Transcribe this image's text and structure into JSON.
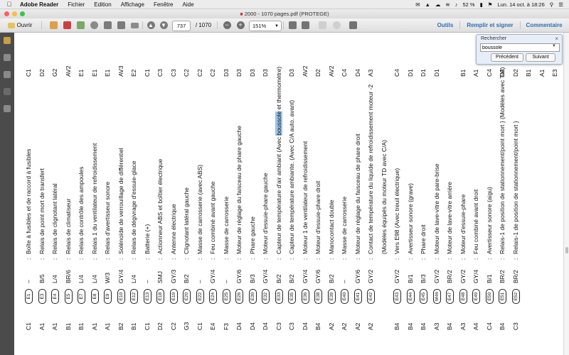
{
  "menubar": {
    "app_name": "Adobe Reader",
    "menus": [
      "Fichier",
      "Edition",
      "Affichage",
      "Fenêtre",
      "Aide"
    ],
    "battery": "52 %",
    "datetime": "Lun. 14 oct. à 18:26"
  },
  "window": {
    "title": "2000 - 1070 pages.pdf (PROTEGE)"
  },
  "toolbar": {
    "open_label": "Ouvrir",
    "page_current": "737",
    "page_total": "/ 1070",
    "zoom": "151%",
    "tools_label": "Outils",
    "fill_sign_label": "Remplir et signer",
    "comment_label": "Commentaire"
  },
  "search": {
    "title": "Rechercher",
    "query": "boussole",
    "prev_label": "Précédent",
    "next_label": "Suivant"
  },
  "document": {
    "rows": [
      {
        "ref": "C1",
        "code": "E1",
        "wire": "–",
        "desc": "Boîte à fusibles et de raccord à fusibles",
        "grid": "C1"
      },
      {
        "ref": "A1",
        "code": "E3",
        "wire": "B/5",
        "desc": "Relais de point mort de transfert",
        "grid": "D2"
      },
      {
        "ref": "A1",
        "code": "E4",
        "wire": "L/4",
        "desc": "Relais de clignotant latéral",
        "grid": "G2"
      },
      {
        "ref": "B1",
        "code": "E5",
        "wire": "BR/6",
        "desc": "Relais de climatiseur",
        "grid": "AV2"
      },
      {
        "ref": "B1",
        "code": "E7",
        "wire": "L/4",
        "desc": "Relais de contrôle des ampoules",
        "grid": "E1"
      },
      {
        "ref": "A1",
        "code": "E8",
        "wire": "L/4",
        "desc": "Relais 1 du ventilateur de refroidissement",
        "grid": "E1"
      },
      {
        "ref": "A1",
        "code": "E9",
        "wire": "W/3",
        "desc": "Relais d'avertisseur sonore",
        "grid": "E1"
      },
      {
        "ref": "B2",
        "code": "E10",
        "wire": "GY/4",
        "desc": "Solénoïde de verrouillage de différentiel",
        "grid": "AV3"
      },
      {
        "ref": "B1",
        "code": "E12",
        "wire": "L/4",
        "desc": "Relais de dégivrage d'essuie-glace",
        "grid": "E2"
      },
      {
        "ref": "C1",
        "code": "E13",
        "wire": "–",
        "desc": "Batterie (+)",
        "grid": "C1"
      },
      {
        "ref": "D2",
        "code": "E18",
        "wire": "SMJ",
        "desc": "Actionneur ABS et boîtier électrique",
        "grid": "C3"
      },
      {
        "ref": "C2",
        "code": "E19",
        "wire": "GY/3",
        "desc": "Antenne électrique",
        "grid": "C3"
      },
      {
        "ref": "G3",
        "code": "E20",
        "wire": "B/2",
        "desc": "Clignotant latéral gauche",
        "grid": "C2"
      },
      {
        "ref": "C1",
        "code": "E22",
        "wire": "–",
        "desc": "Masse de carrosserie (avec ABS)",
        "grid": "C2"
      },
      {
        "ref": "E4",
        "code": "E24",
        "wire": "GY/4",
        "desc": "Feu combiné avant gauche",
        "grid": "C2"
      },
      {
        "ref": "F3",
        "code": "E25",
        "wire": "–",
        "desc": "Masse de carrosserie",
        "grid": "D3"
      },
      {
        "ref": "D4",
        "code": "E26",
        "wire": "GY/6",
        "desc": "Moteur de réglage du faisceau de phare gauche",
        "grid": "D3"
      },
      {
        "ref": "D4",
        "code": "E30",
        "wire": "B/3",
        "desc": "Phare gauche",
        "grid": "D3"
      },
      {
        "ref": "D4",
        "code": "E32",
        "wire": "GY/4",
        "desc": "Moteur d'essuie-phare gauche",
        "grid": "D3"
      },
      {
        "ref": "C3",
        "code": "E33",
        "wire": "B/2",
        "desc": "Capteur de température d'air ambiant (Avec boussole et thermomètre)",
        "hl": "boussole",
        "grid": ""
      },
      {
        "ref": "C3",
        "code": "E35",
        "wire": "B/2",
        "desc": "Capteur de température ambiante. (Avec C/A auto. avant)",
        "grid": "D3"
      },
      {
        "ref": "D4",
        "code": "E36",
        "wire": "GY/4",
        "desc": "Moteur 1 de ventilateur de refroidissement",
        "grid": "AV2"
      },
      {
        "ref": "B4",
        "code": "E38",
        "wire": "GY/6",
        "desc": "Moteur d'essuie-phare droit",
        "grid": "D2"
      },
      {
        "ref": "A2",
        "code": "E39",
        "wire": "B/2",
        "desc": "Manocontact double",
        "grid": "AV2"
      },
      {
        "ref": "A2",
        "code": "E40",
        "wire": "–",
        "desc": "Masse de carrosserie",
        "grid": "C4"
      },
      {
        "ref": "A2",
        "code": "E41",
        "wire": "GY/6",
        "desc": "Moteur de réglage du faisceau de phare droit",
        "grid": "D4"
      },
      {
        "ref": "A2",
        "code": "E42",
        "wire": "GY/2",
        "desc": "Contact de température du liquide de refroidissement moteur -2",
        "grid": "A3"
      },
      {
        "ref": "",
        "code": "",
        "wire": "",
        "desc": "(Modèles équipés du moteur TD avec C/A)",
        "grid": ""
      },
      {
        "ref": "B4",
        "code": "E43",
        "wire": "GY/2",
        "desc": "Vers E98 (Avec treuil électrique)",
        "grid": "C4"
      },
      {
        "ref": "B4",
        "code": "E44",
        "wire": "B/1",
        "desc": "Avertisseur sonore (grave)",
        "grid": "D1"
      },
      {
        "ref": "B4",
        "code": "E45",
        "wire": "B/3",
        "desc": "Phare droit",
        "grid": "D1"
      },
      {
        "ref": "A3",
        "code": "M46",
        "wire": "GY/2",
        "desc": "Moteur de lave-vitre de pare-brise",
        "grid": "D1"
      },
      {
        "ref": "B4",
        "code": "E47",
        "wire": "BR/2",
        "desc": "Moteur de lave-vitre arrière",
        "grid": ""
      },
      {
        "ref": "A3",
        "code": "E48",
        "wire": "GY/2",
        "desc": "Moteur d'essuie-phare",
        "grid": "B1"
      },
      {
        "ref": "A4",
        "code": "E49",
        "wire": "GY/4",
        "desc": "Feu combiné avant droit",
        "grid": "A1"
      },
      {
        "ref": "C4",
        "code": "E50",
        "wire": "B/1",
        "desc": "Avertisseur sonore (aigu)",
        "grid": "C4"
      },
      {
        "ref": "B4",
        "code": "E51",
        "wire": "BR/2",
        "desc": "Relais-1 de position de stationnement/point mort  } (Modèles avec T/A)",
        "grid": "D2"
      },
      {
        "ref": "C3",
        "code": "E52",
        "wire": "BR/2",
        "desc": "Relais-1 de position de stationnement/point mort  }",
        "grid": "D2"
      },
      {
        "ref": "",
        "code": "",
        "wire": "",
        "desc": "",
        "grid": "B1"
      },
      {
        "ref": "",
        "code": "",
        "wire": "",
        "desc": "",
        "grid": "A1"
      },
      {
        "ref": "",
        "code": "",
        "wire": "",
        "desc": "",
        "grid": "E3"
      }
    ]
  }
}
